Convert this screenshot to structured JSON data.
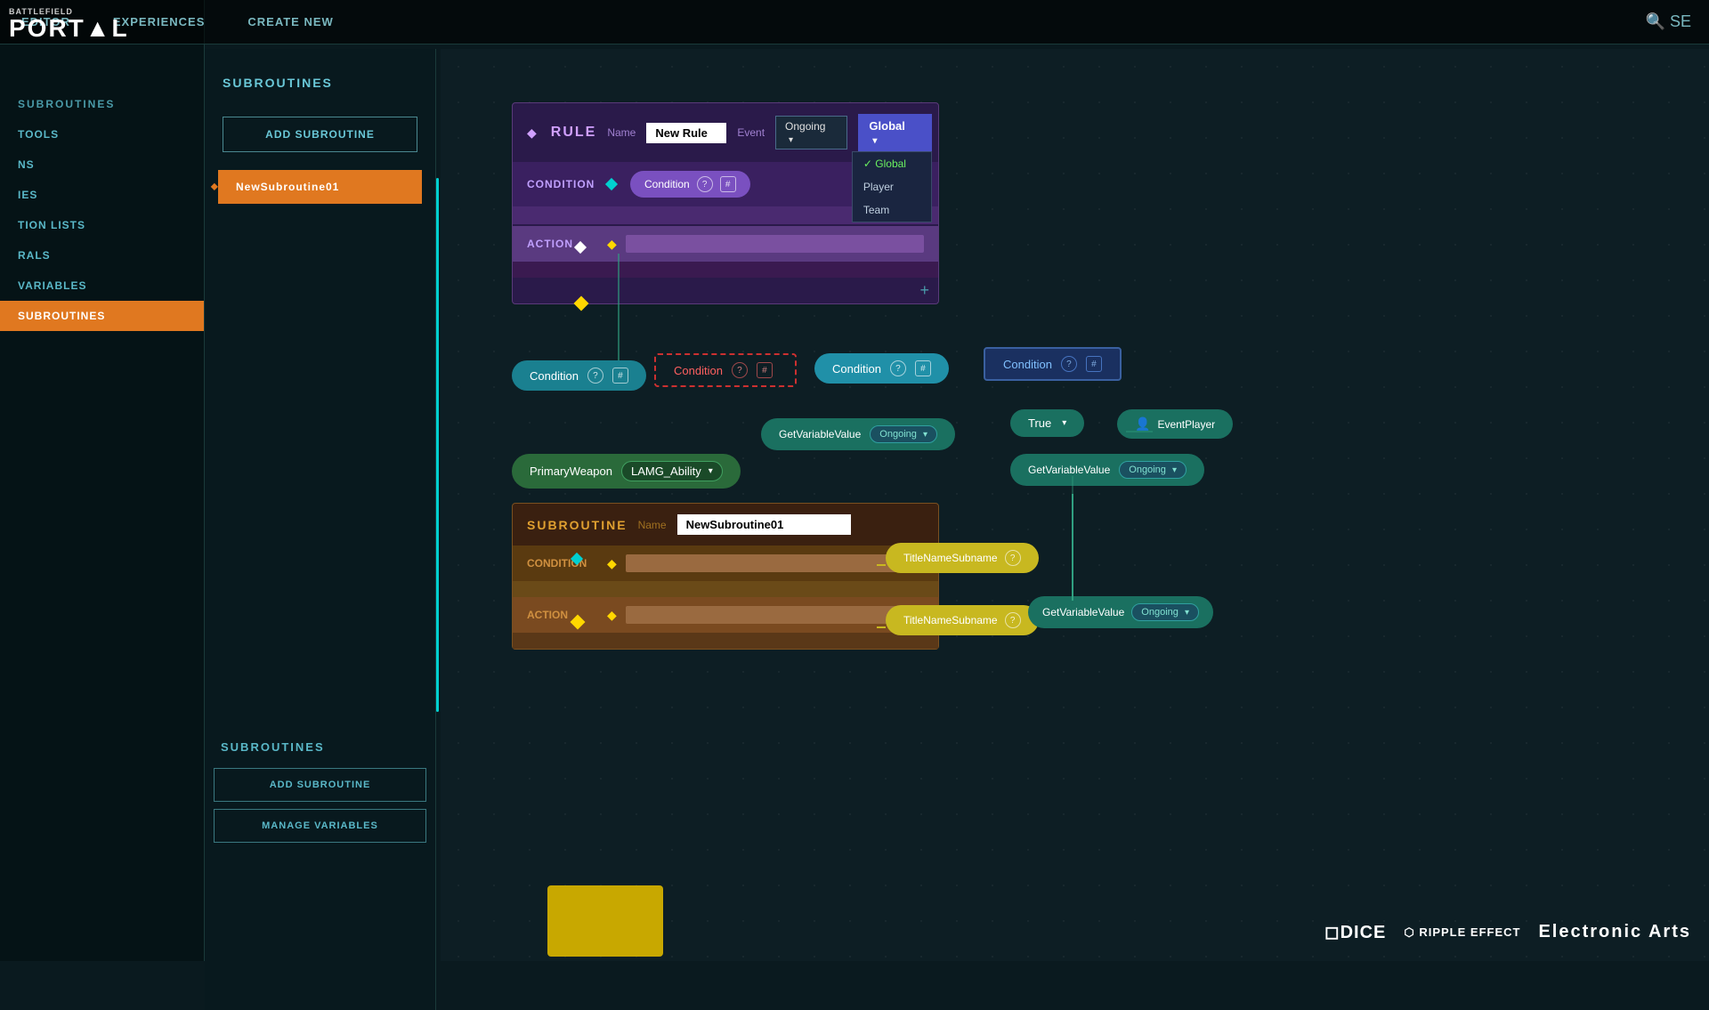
{
  "branding": {
    "battlefield_label": "BATTLEFIELD",
    "portal_label": "PORT▲L"
  },
  "nav": {
    "editor_label": "EDITOR",
    "experiences_label": "EXPERIENCES",
    "create_new_label": "CREATE NEW",
    "search_label": "🔍 SE"
  },
  "sidebar": {
    "subroutines_header": "SUBROUTINES",
    "items": [
      {
        "label": "TOOLS"
      },
      {
        "label": "NS"
      },
      {
        "label": "IES"
      },
      {
        "label": "TION LISTS"
      },
      {
        "label": "RALS"
      },
      {
        "label": "VARIABLES"
      },
      {
        "label": "SUBROUTINES"
      }
    ],
    "add_subroutine_btn": "ADD SUBROUTINE",
    "subroutine01": "NewSubroutine01",
    "bottom_add_btn": "ADD SUBROUTINE",
    "bottom_manage_btn": "MANAGE VARIABLES"
  },
  "rule_block": {
    "header_label": "RULE",
    "name_label": "Name",
    "name_value": "New Rule",
    "event_label": "Event",
    "event_value": "Ongoing",
    "global_label": "Global",
    "dropdown_options": [
      "Global",
      "Player",
      "Team"
    ],
    "selected_option": "Global",
    "condition_label": "CONDITION",
    "condition_node": "Condition",
    "action_label": "ACTION"
  },
  "floating_nodes": {
    "condition_cyan": "Condition",
    "condition_red": "Condition",
    "condition_light_blue": "Condition",
    "condition_dark_blue": "Condition",
    "get_variable_label": "GetVariableValue",
    "ongoing_label": "Ongoing",
    "event_player_label": "EventPlayer",
    "true_label": "True",
    "primary_weapon_label": "PrimaryWeapon",
    "lamg_ability_label": "LAMG_Ability"
  },
  "subroutine_block": {
    "header_label": "SUBROUTINE",
    "name_label": "Name",
    "name_value": "NewSubroutine01",
    "condition_label": "CONDITION",
    "action_label": "ACTION"
  },
  "title_nodes": {
    "title1": "TitleNameSubname",
    "title2": "TitleNameSubname",
    "get_var_label": "GetVariableValue",
    "ongoing_label": "Ongoing"
  },
  "icons": {
    "question": "?",
    "hash": "#",
    "caret_down": "▾",
    "diamond": "◆",
    "person": "👤",
    "checkmark": "✓",
    "plus": "+"
  }
}
